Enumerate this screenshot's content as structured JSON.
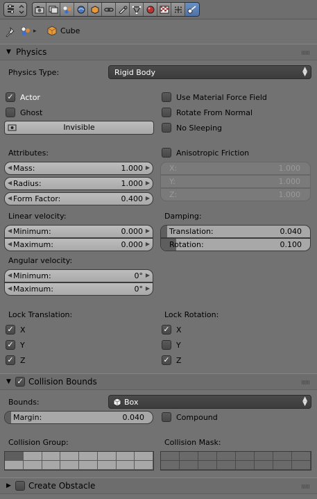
{
  "header": {
    "editor_type": "Properties",
    "context_icons": [
      "render-icon",
      "render-layers-icon",
      "scene-icon",
      "world-icon",
      "object-icon",
      "constraints-icon",
      "modifiers-icon",
      "data-icon",
      "material-icon",
      "texture-icon",
      "particles-icon",
      "physics-icon"
    ],
    "active_context": "physics-icon"
  },
  "breadcrumb": {
    "object_name": "Cube"
  },
  "physics": {
    "title": "Physics",
    "type_label": "Physics Type:",
    "type_value": "Rigid Body",
    "actor": "Actor",
    "ghost": "Ghost",
    "invisible": "Invisible",
    "use_material_force_field": "Use Material Force Field",
    "rotate_from_normal": "Rotate From Normal",
    "no_sleeping": "No Sleeping",
    "attributes_label": "Attributes:",
    "mass_label": "Mass:",
    "mass_value": "1.000",
    "radius_label": "Radius:",
    "radius_value": "1.000",
    "form_factor_label": "Form Factor:",
    "form_factor_value": "0.400",
    "anisotropic_friction": "Anisotropic Friction",
    "aniso_x_label": "X:",
    "aniso_x_value": "1.000",
    "aniso_y_label": "Y:",
    "aniso_y_value": "1.000",
    "aniso_z_label": "Z:",
    "aniso_z_value": "1.000",
    "linear_velocity_label": "Linear velocity:",
    "lin_min_label": "Minimum:",
    "lin_min_value": "0.000",
    "lin_max_label": "Maximum:",
    "lin_max_value": "0.000",
    "damping_label": "Damping:",
    "translation_label": "Translation:",
    "translation_value": "0.040",
    "rotation_label": "Rotation:",
    "rotation_value": "0.100",
    "angular_velocity_label": "Angular velocity:",
    "ang_min_label": "Minimum:",
    "ang_min_value": "0°",
    "ang_max_label": "Maximum:",
    "ang_max_value": "0°",
    "lock_translation_label": "Lock Translation:",
    "lock_rotation_label": "Lock Rotation:",
    "lock_t_x": "X",
    "lock_t_y": "Y",
    "lock_t_z": "Z",
    "lock_r_x": "X",
    "lock_r_y": "Y",
    "lock_r_z": "Z",
    "checks": {
      "actor": true,
      "ghost": false,
      "use_material_force_field": false,
      "rotate_from_normal": false,
      "no_sleeping": false,
      "anisotropic_friction": false,
      "lock_t_x": true,
      "lock_t_y": true,
      "lock_t_z": true,
      "lock_r_x": true,
      "lock_r_y": false,
      "lock_r_z": true
    }
  },
  "collision": {
    "title": "Collision Bounds",
    "enabled": true,
    "bounds_label": "Bounds:",
    "bounds_value": "Box",
    "margin_label": "Margin:",
    "margin_value": "0.040",
    "compound": "Compound",
    "compound_checked": false,
    "group_label": "Collision Group:",
    "mask_label": "Collision Mask:"
  },
  "obstacle": {
    "title": "Create Obstacle",
    "enabled": false
  },
  "colors": {
    "panel_bg": "#727272",
    "field_bg": "#a9a9a9",
    "menu_bg": "#3c3c3c",
    "active_tab": "#5680c2"
  }
}
